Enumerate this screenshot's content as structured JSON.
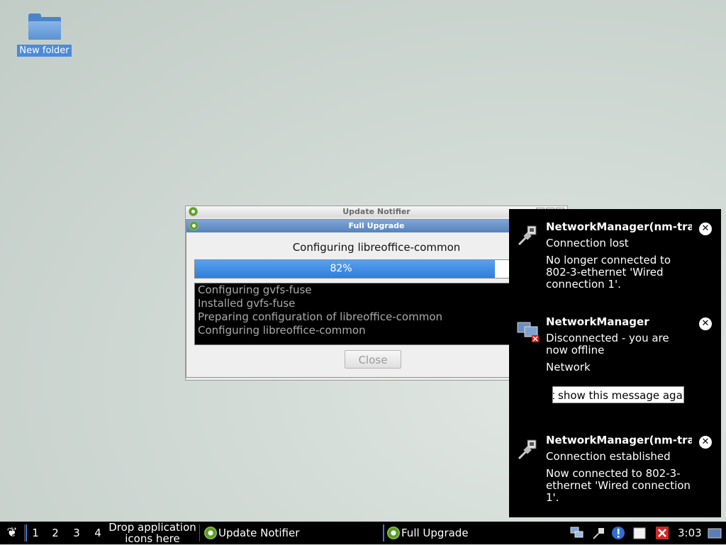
{
  "desktop": {
    "icons": [
      {
        "label": "New folder",
        "icon": "folder-icon"
      }
    ]
  },
  "update_notifier": {
    "title": "Update Notifier"
  },
  "full_upgrade": {
    "title": "Full Upgrade",
    "status": "Configuring libreoffice-common",
    "progress_percent": 82,
    "progress_label": "82%",
    "log": [
      "Configuring gvfs-fuse",
      "Installed gvfs-fuse",
      "Preparing configuration of libreoffice-common",
      "Configuring libreoffice-common"
    ],
    "close_label": "Close"
  },
  "notifications": [
    {
      "title": "NetworkManager(nm-tra",
      "summary": "Connection lost",
      "body": "No longer connected to 802-3-ethernet 'Wired connection 1'.",
      "icon": "network-plug-icon"
    },
    {
      "title": "NetworkManager",
      "summary": "Disconnected - you are now offline",
      "body": "Network",
      "action": "Don't show this message again",
      "icon": "network-offline-icon"
    },
    {
      "title": "NetworkManager(nm-tra",
      "summary": "Connection established",
      "body": "Now connected to 802-3-ethernet 'Wired connection 1'.",
      "icon": "network-plug-icon"
    }
  ],
  "taskbar": {
    "workspaces": [
      "1",
      "2",
      "3",
      "4"
    ],
    "launcher_hint": "Drop application icons here",
    "tasks": [
      {
        "label": "Update Notifier",
        "icon": "update-gear-icon"
      },
      {
        "label": "Full Upgrade",
        "icon": "update-gear-icon"
      }
    ],
    "tray_icons": [
      "network-icon",
      "plug-icon",
      "info-icon",
      "clipboard-icon",
      "close-red-icon"
    ],
    "clock": "3:03",
    "colors": {
      "accent": "#3a7ad0",
      "progress": "#2f7fd9"
    }
  }
}
